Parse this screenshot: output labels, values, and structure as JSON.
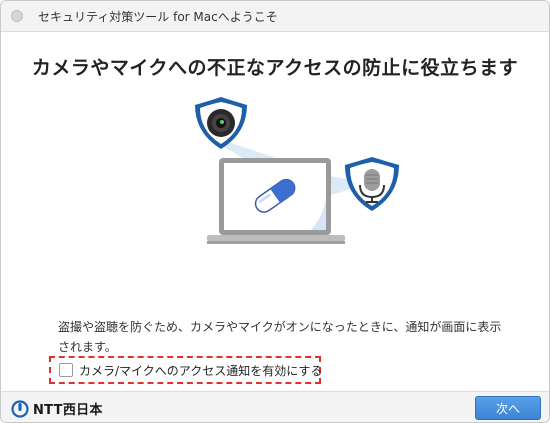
{
  "window": {
    "title": "セキュリティ対策ツール for Macへようこそ"
  },
  "main": {
    "headline": "カメラやマイクへの不正なアクセスの防止に役立ちます",
    "description": "盗撮や盗聴を防ぐため、カメラやマイクがオンになったときに、通知が画面に表示されます。",
    "consent_label": "カメラ/マイクへのアクセス通知を有効にする",
    "consent_checked": false
  },
  "footer": {
    "logo_text": "NTT西日本",
    "next_label": "次へ"
  },
  "colors": {
    "accent": "#3c84d6",
    "highlight_border": "#e0312f",
    "shield": "#1d5fa8"
  }
}
